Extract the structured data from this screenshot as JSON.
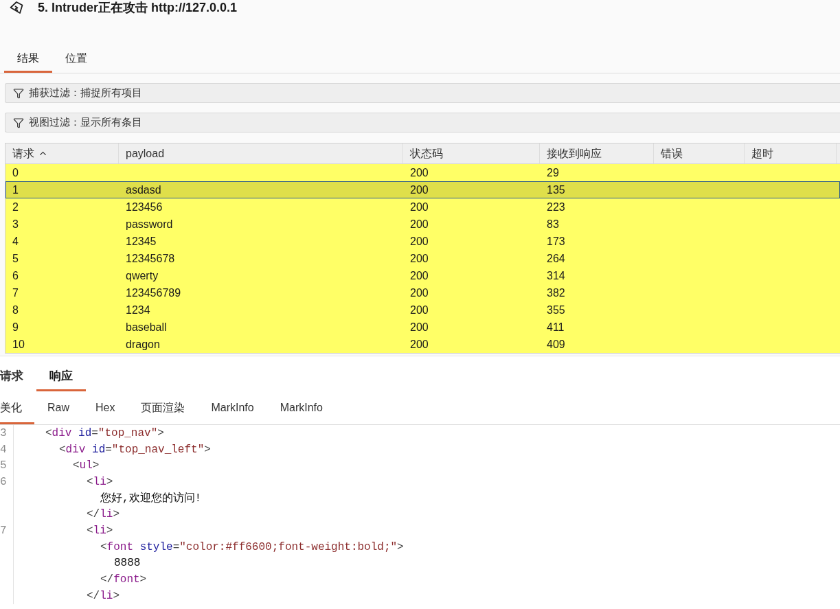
{
  "window": {
    "title": "5. Intruder正在攻击 http://127.0.0.1"
  },
  "tabs": [
    {
      "label": "结果",
      "selected": true
    },
    {
      "label": "位置",
      "selected": false
    }
  ],
  "filters": [
    {
      "label": "捕获过滤：捕捉所有项目"
    },
    {
      "label": "视图过滤：显示所有条目"
    }
  ],
  "table": {
    "columns": [
      {
        "label": "请求",
        "sorted": true
      },
      {
        "label": "payload",
        "sorted": false
      },
      {
        "label": "状态码",
        "sorted": false
      },
      {
        "label": "接收到响应",
        "sorted": false
      },
      {
        "label": "错误",
        "sorted": false
      },
      {
        "label": "超时",
        "sorted": false
      }
    ],
    "rows": [
      {
        "request": "0",
        "status_code": "200",
        "response_received": "29",
        "color": "#ffff66",
        "selected": false
      },
      {
        "request": "1",
        "payload": "asdasd",
        "status_code": "200",
        "response_received": "135",
        "color": "#dfdf4a",
        "selected": true
      },
      {
        "request": "2",
        "payload": "123456",
        "status_code": "200",
        "response_received": "223",
        "color": "#ffff66",
        "selected": false
      },
      {
        "request": "3",
        "payload": "password",
        "status_code": "200",
        "response_received": "83",
        "color": "#ffff66",
        "selected": false
      },
      {
        "request": "4",
        "payload": "12345",
        "status_code": "200",
        "response_received": "173",
        "color": "#ffff66",
        "selected": false
      },
      {
        "request": "5",
        "payload": "12345678",
        "status_code": "200",
        "response_received": "264",
        "color": "#ffff66",
        "selected": false
      },
      {
        "request": "6",
        "payload": "qwerty",
        "status_code": "200",
        "response_received": "314",
        "color": "#ffff66",
        "selected": false
      },
      {
        "request": "7",
        "payload": "123456789",
        "status_code": "200",
        "response_received": "382",
        "color": "#ffff66",
        "selected": false
      },
      {
        "request": "8",
        "payload": "1234",
        "status_code": "200",
        "response_received": "355",
        "color": "#ffff66",
        "selected": false
      },
      {
        "request": "9",
        "payload": "baseball",
        "status_code": "200",
        "response_received": "411",
        "color": "#ffff66",
        "selected": false
      },
      {
        "request": "10",
        "payload": "dragon",
        "status_code": "200",
        "response_received": "409",
        "color": "#ffff66",
        "selected": false
      }
    ]
  },
  "message_tabs": [
    {
      "label": "请求",
      "selected": false
    },
    {
      "label": "响应",
      "selected": true
    }
  ],
  "view_tabs": [
    {
      "label": "美化",
      "selected": true
    },
    {
      "label": "Raw",
      "selected": false
    },
    {
      "label": "Hex",
      "selected": false
    },
    {
      "label": "页面渲染",
      "selected": false
    },
    {
      "label": "MarkInfo",
      "selected": false
    },
    {
      "label": "MarkInfo",
      "selected": false
    }
  ],
  "code": {
    "lines": [
      {
        "number": "3",
        "line": [
          {
            "kind": "punct",
            "text": "<"
          },
          {
            "kind": "tag",
            "text": "div"
          },
          {
            "kind": "attr",
            "text": "id"
          },
          {
            "kind": "punct",
            "text": "="
          },
          {
            "kind": "string",
            "text": "\"top_nav\""
          },
          {
            "kind": "punct",
            "text": ">"
          }
        ],
        "children": [
          {
            "number": "4",
            "line": [
              {
                "kind": "punct",
                "text": "<"
              },
              {
                "kind": "tag",
                "text": "div"
              },
              {
                "kind": "attr",
                "text": "id"
              },
              {
                "kind": "punct",
                "text": "="
              },
              {
                "kind": "string",
                "text": "\"top_nav_left\""
              },
              {
                "kind": "punct",
                "text": ">"
              }
            ],
            "children": [
              {
                "number": "5",
                "line": [
                  {
                    "kind": "punct",
                    "text": "<"
                  },
                  {
                    "kind": "tag",
                    "text": "ul"
                  },
                  {
                    "kind": "punct",
                    "text": ">"
                  }
                ],
                "children": [
                  {
                    "number": "6",
                    "line": [
                      {
                        "kind": "punct",
                        "text": "<"
                      },
                      {
                        "kind": "tag",
                        "text": "li"
                      },
                      {
                        "kind": "punct",
                        "text": ">"
                      }
                    ],
                    "children": [
                      {
                        "line": [
                          {
                            "kind": "text",
                            "text": "您好,欢迎您的访问!"
                          }
                        ]
                      }
                    ],
                    "closing_line": [
                      {
                        "kind": "punct",
                        "text": "</"
                      },
                      {
                        "kind": "tag",
                        "text": "li"
                      },
                      {
                        "kind": "punct",
                        "text": ">"
                      }
                    ]
                  },
                  {
                    "number": "7",
                    "line": [
                      {
                        "kind": "punct",
                        "text": "<"
                      },
                      {
                        "kind": "tag",
                        "text": "li"
                      },
                      {
                        "kind": "punct",
                        "text": ">"
                      }
                    ],
                    "children": [
                      {
                        "line": [
                          {
                            "kind": "punct",
                            "text": "<"
                          },
                          {
                            "kind": "tag",
                            "text": "font"
                          },
                          {
                            "kind": "attr",
                            "text": "style"
                          },
                          {
                            "kind": "punct",
                            "text": "="
                          },
                          {
                            "kind": "string",
                            "text": "\"color:#ff6600;font-weight:bold;\""
                          },
                          {
                            "kind": "punct",
                            "text": ">"
                          }
                        ],
                        "children": [
                          {
                            "line": [
                              {
                                "kind": "text",
                                "text": "8888"
                              }
                            ]
                          }
                        ],
                        "closing_line": [
                          {
                            "kind": "punct",
                            "text": "</"
                          },
                          {
                            "kind": "tag",
                            "text": "font"
                          },
                          {
                            "kind": "punct",
                            "text": ">"
                          }
                        ]
                      }
                    ],
                    "closing_line": [
                      {
                        "kind": "punct",
                        "text": "</"
                      },
                      {
                        "kind": "tag",
                        "text": "li"
                      },
                      {
                        "kind": "punct",
                        "text": ">"
                      }
                    ]
                  }
                ]
              }
            ]
          }
        ]
      }
    ]
  }
}
